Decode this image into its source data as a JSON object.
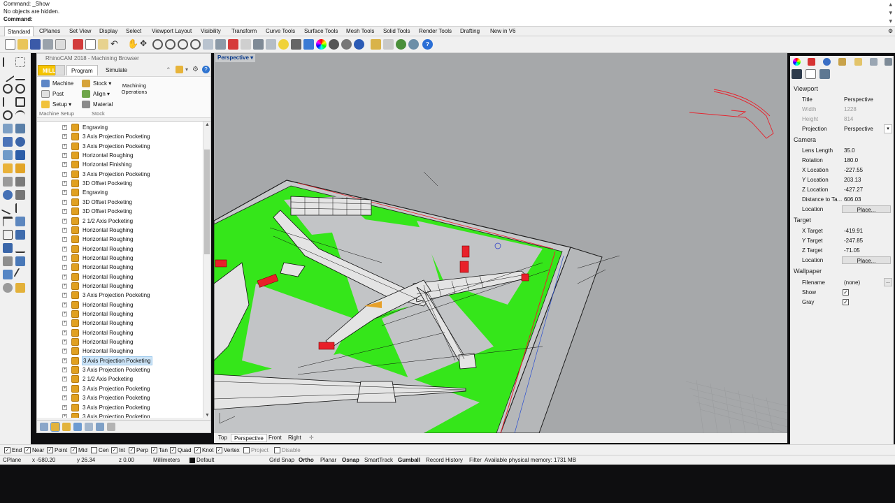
{
  "command": {
    "line1": "Command: _Show",
    "line2": "No objects are hidden.",
    "prompt": "Command:"
  },
  "tabs": [
    "Standard",
    "CPlanes",
    "Set View",
    "Display",
    "Select",
    "Viewport Layout",
    "Visibility",
    "Transform",
    "Curve Tools",
    "Surface Tools",
    "Mesh Tools",
    "Solid Tools",
    "Render Tools",
    "Drafting",
    "New in V6"
  ],
  "browser": {
    "title": "RhinoCAM 2018 - Machining Browser",
    "tab_mill": "MILL",
    "tab_program": "Program",
    "tab_simulate": "Simulate",
    "ribbon": {
      "machine": "Machine",
      "post": "Post",
      "setup": "Setup",
      "stock": "Stock",
      "align": "Align",
      "material": "Material",
      "machining_operations": "Machining Operations",
      "group_machine_setup": "Machine Setup",
      "group_stock": "Stock"
    },
    "operations": [
      "Engraving",
      "3 Axis Projection Pocketing",
      "3 Axis Projection Pocketing",
      "Horizontal Roughing",
      "Horizontal Finishing",
      "3 Axis Projection Pocketing",
      "3D Offset Pocketing",
      "Engraving",
      "3D Offset Pocketing",
      "3D Offset Pocketing",
      "2 1/2 Axis Pocketing",
      "Horizontal Roughing",
      "Horizontal Roughing",
      "Horizontal Roughing",
      "Horizontal Roughing",
      "Horizontal Roughing",
      "Horizontal Roughing",
      "Horizontal Roughing",
      "3 Axis Projection Pocketing",
      "Horizontal Roughing",
      "Horizontal Roughing",
      "Horizontal Roughing",
      "Horizontal Roughing",
      "Horizontal Roughing",
      "Horizontal Roughing",
      "3 Axis Projection Pocketing",
      "3 Axis Projection Pocketing",
      "2 1/2 Axis Pocketing",
      "3 Axis Projection Pocketing",
      "3 Axis Projection Pocketing",
      "3 Axis Projection Pocketing",
      "3 Axis Projection Pocketing"
    ],
    "selected_index": 25
  },
  "viewport": {
    "label": "Perspective",
    "tabs": [
      "Top",
      "Perspective",
      "Front",
      "Right"
    ],
    "active_tab": "Perspective",
    "colors": {
      "green": "#35e61a",
      "red": "#e8202a",
      "bg": "#a6a8aa"
    }
  },
  "props": {
    "viewport_section": "Viewport",
    "title_k": "Title",
    "title_v": "Perspective",
    "width_k": "Width",
    "width_v": "1228",
    "height_k": "Height",
    "height_v": "814",
    "projection_k": "Projection",
    "projection_v": "Perspective",
    "camera_section": "Camera",
    "lens_k": "Lens Length",
    "lens_v": "35.0",
    "rotation_k": "Rotation",
    "rotation_v": "180.0",
    "xloc_k": "X Location",
    "xloc_v": "-227.55",
    "yloc_k": "Y Location",
    "yloc_v": "203.13",
    "zloc_k": "Z Location",
    "zloc_v": "-427.27",
    "dist_k": "Distance to Ta...",
    "dist_v": "606.03",
    "location_k": "Location",
    "place_btn": "Place...",
    "target_section": "Target",
    "xt_k": "X Target",
    "xt_v": "-419.91",
    "yt_k": "Y Target",
    "yt_v": "-247.85",
    "zt_k": "Z Target",
    "zt_v": "-71.05",
    "tloc_k": "Location",
    "wallpaper_section": "Wallpaper",
    "filename_k": "Filename",
    "filename_v": "(none)",
    "show_k": "Show",
    "gray_k": "Gray"
  },
  "osnap": {
    "end": "End",
    "near": "Near",
    "point": "Point",
    "mid": "Mid",
    "cen": "Cen",
    "int": "Int",
    "perp": "Perp",
    "tan": "Tan",
    "quad": "Quad",
    "knot": "Knot",
    "vertex": "Vertex",
    "project": "Project",
    "disable": "Disable"
  },
  "status": {
    "cplane": "CPlane",
    "x": "x -580.20",
    "y": "y 26.34",
    "z": "z 0.00",
    "units": "Millimeters",
    "layer": "Default",
    "grid_snap": "Grid Snap",
    "ortho": "Ortho",
    "planar": "Planar",
    "osnap": "Osnap",
    "smarttrack": "SmartTrack",
    "gumball": "Gumball",
    "record_history": "Record History",
    "filter": "Filter",
    "memory": "Available physical memory: 1731 MB"
  }
}
